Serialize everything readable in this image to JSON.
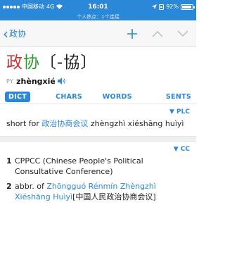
{
  "status": {
    "carrier": "中国移动",
    "network": "4G",
    "time": "16:01",
    "battery": "92%"
  },
  "hotspot_text": "个人热点：1个连接",
  "nav": {
    "back_label": "政协"
  },
  "entry": {
    "headword_char1": "政",
    "headword_char2": "协",
    "bracket_open": "〔",
    "variant": "-協",
    "bracket_close": "〕",
    "py_tag": "PY",
    "pinyin": "zhèngxié"
  },
  "tabs": [
    "DICT",
    "CHARS",
    "WORDS",
    "SENTS"
  ],
  "plc_section": {
    "flag": "▼ PLC",
    "prefix": "short for ",
    "link": "政治协商会议",
    "suffix": " zhèngzhì xiéshāng huìyì"
  },
  "cc_section": {
    "flag": "▼ CC",
    "senses": [
      {
        "num": "1",
        "text": "CPPCC (Chinese People's Political Consultative Conference)"
      },
      {
        "num": "2",
        "prefix": "abbr. of ",
        "link": "Zhōngguó Rénmín Zhèngzhì Xiéshāng Huìyì",
        "suffix": "[中国人民政治协商会议]"
      }
    ]
  },
  "colors": {
    "accent": "#2b87d8",
    "tone_red": "#d32f2f",
    "tone_green": "#2e9a2e"
  }
}
